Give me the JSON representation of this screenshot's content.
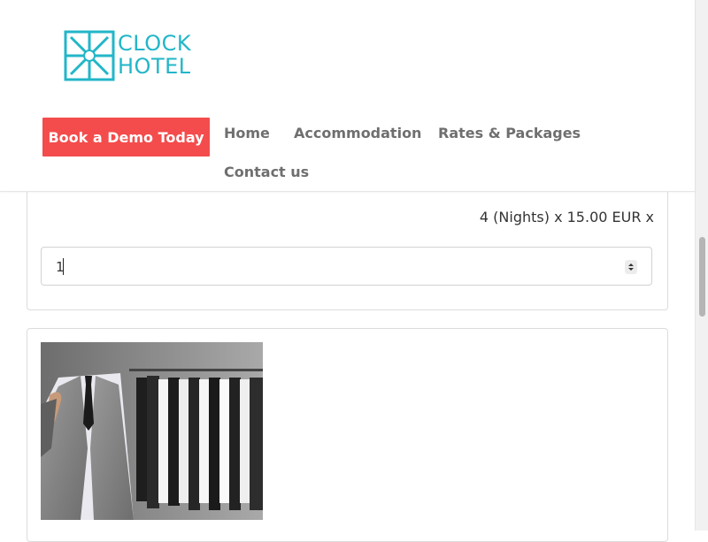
{
  "brand": {
    "line1": "CLOCK",
    "line2": "HOTEL",
    "color": "#22b6c8",
    "icon": "clock-hotel-logo-icon"
  },
  "header": {
    "cta_label": "Book a Demo Today",
    "cta_color": "#f44c4c",
    "nav": {
      "home": "Home",
      "accommodation": "Accommodation",
      "rates": "Rates & Packages",
      "contact": "Contact us"
    }
  },
  "extra_service": {
    "price_text": "4 (Nights) x 15.00 EUR x",
    "quantity": "1",
    "spinner_icon": "up-down-spinner-icon"
  },
  "service_card": {
    "image": "man-in-vest-with-clothes-rack-photo"
  }
}
